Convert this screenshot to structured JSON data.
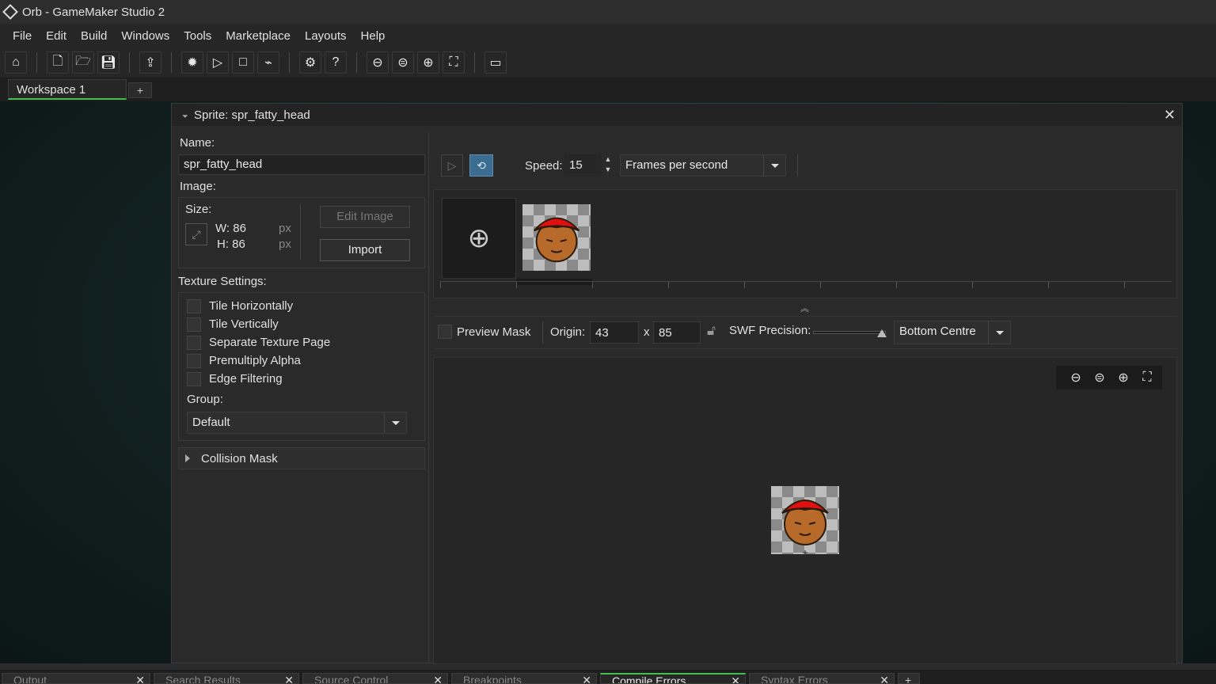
{
  "window": {
    "title": "Orb - GameMaker Studio 2"
  },
  "menu": [
    "File",
    "Edit",
    "Build",
    "Windows",
    "Tools",
    "Marketplace",
    "Layouts",
    "Help"
  ],
  "toolbar": {
    "icons": [
      "home-icon",
      "new-icon",
      "open-icon",
      "save-icon",
      "export-icon",
      "debug-icon",
      "run-icon",
      "stop-icon",
      "clean-icon",
      "settings-icon",
      "help-icon",
      "zoom-out-icon",
      "zoom-reset-icon",
      "zoom-in-icon",
      "fit-icon",
      "monitor-icon"
    ]
  },
  "workspace_tab": {
    "label": "Workspace 1",
    "add": "+"
  },
  "sprite_editor": {
    "title": "Sprite: spr_fatty_head",
    "close": "✕",
    "name_label": "Name:",
    "name_value": "spr_fatty_head",
    "image_label": "Image:",
    "size_label": "Size:",
    "width": "W: 86",
    "height": "H: 86",
    "px1": "px",
    "px2": "px",
    "edit_image": "Edit Image",
    "import": "Import",
    "texture_label": "Texture Settings:",
    "texture_options": [
      "Tile Horizontally",
      "Tile Vertically",
      "Separate Texture Page",
      "Premultiply Alpha",
      "Edge Filtering"
    ],
    "group_label": "Group:",
    "group_value": "Default",
    "collision_mask": "Collision Mask",
    "speed_label": "Speed:",
    "speed_value": "15",
    "speed_unit": "Frames per second",
    "preview_mask": "Preview Mask",
    "origin_label": "Origin:",
    "origin_x": "43",
    "origin_sep": "x",
    "origin_y": "85",
    "swf_label": "SWF Precision:",
    "origin_preset": "Bottom Centre"
  },
  "bottom_tabs": [
    {
      "label": "Output",
      "active": false
    },
    {
      "label": "Search Results",
      "active": false
    },
    {
      "label": "Source Control",
      "active": false
    },
    {
      "label": "Breakpoints",
      "active": false
    },
    {
      "label": "Compile Errors",
      "active": true
    },
    {
      "label": "Syntax Errors",
      "active": false
    }
  ],
  "colors": {
    "accent": "#3fbf4f",
    "turban": "#e01010",
    "face": "#b86a2a"
  }
}
